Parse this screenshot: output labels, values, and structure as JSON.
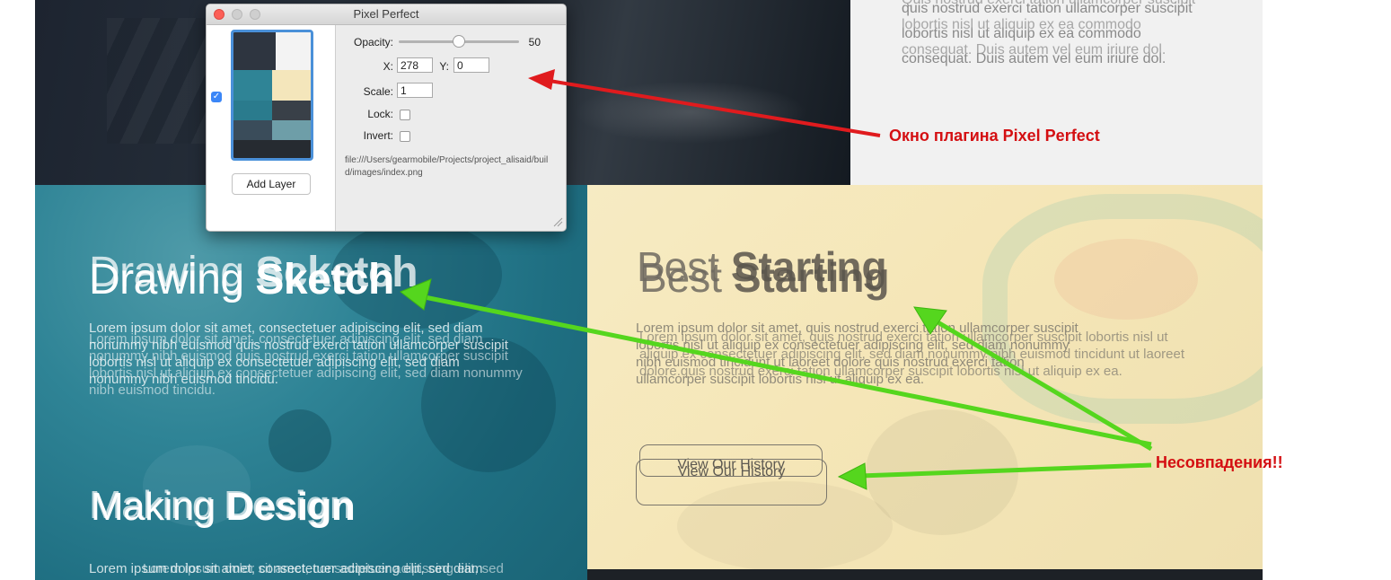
{
  "plugin": {
    "title": "Pixel Perfect",
    "opacity_label": "Opacity:",
    "opacity_value": "50",
    "opacity_fraction": 0.5,
    "x_label": "X:",
    "x_value": "278",
    "y_label": "Y:",
    "y_value": "0",
    "scale_label": "Scale:",
    "scale_value": "1",
    "lock_label": "Lock:",
    "invert_label": "Invert:",
    "file_path": "file:///Users/gearmobile/Projects/project_alisaid/build/images/index.png",
    "add_layer_label": "Add Layer",
    "layer_checked": true
  },
  "page": {
    "top_right_text_a": "Quis nostrud exerci tation ullamcorper suscipit lobortis nisl ut aliquip ex ea commodo consequat. Duis autem vel eum iriure dol.",
    "top_right_text_b": "quis nostrud exerci tation ullamcorper suscipit lobortis nisl ut aliquip ex ea commodo consequat. Duis autem vel eum iriure dol.",
    "drawing_heading_light": "Drawing ",
    "drawing_heading_bold": "Sketch",
    "drawing_heading_bold_b": "Scketch",
    "drawing_text_a": "Lorem ipsum dolor sit amet, consectetuer adipiscing elit, sed diam nonummy nibh euismod quis nostrud exerci tation ullamcorper suscipit lobortis nisl ut aliquip ex consectetuer adipiscing elit, sed diam nonummy nibh euismod tincidu.",
    "drawing_text_b": "Lorem ipsum dolor sit amet, consectetuer adipiscing elit, sed diam nonummy nibh euismod quis nostrud exerci tation ullamcorper suscipit lobortis nisl ut aliquip ex consectetuer adipiscing elit, sed diam nonummy nibh euismod tincidu.",
    "making_heading_light": "Making ",
    "making_heading_bold": "Design",
    "making_text_a": "Lorem ipsum dolor sit amet, consectetuer adipiscing elit, sed diam",
    "making_text_b": "Lorem ipsum dolor sit amet, consectetuer adipiscing elit, sed",
    "best_heading_light": "Best ",
    "best_heading_bold": "Starting",
    "best_text_a": "Lorem ipsum dolor sit amet, quis nostrud exerci tation ullamcorper suscipit lobortis nisl ut aliquip ex consectetuer adipiscing elit, sed diam nonummy nibh euismod tincidunt ut laoreet dolore quis nostrud exerci tation ullamcorper suscipit lobortis nisl ut aliquip ex ea.",
    "best_text_b": "Lorem ipsum dolor sit amet, quis nostrud exerci tation ullamcorper suscipit lobortis nisl ut aliquip ex consectetuer adipiscing elit, sed diam nonummy nibh euismod tincidunt ut laoreet dolore.quis nostrud exerci tation ullamcorper suscipit lobortis nisl ut aliquip ex ea.",
    "history_button_label": "View Our History"
  },
  "annotations": {
    "plugin_window_label": "Окно плагина Pixel Perfect",
    "mismatch_label": "Несовпадения!!",
    "red_color": "#d40f12",
    "green_color": "#55d61e"
  }
}
